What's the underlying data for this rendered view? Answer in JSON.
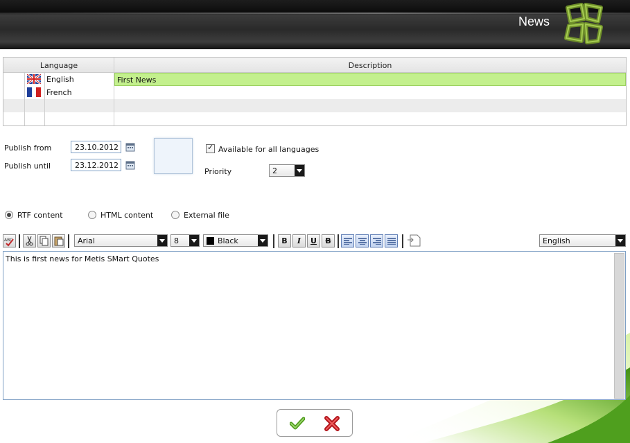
{
  "header": {
    "title": "News",
    "logo": "flower-logo"
  },
  "grid": {
    "columns": [
      "Language",
      "Description"
    ],
    "rows": [
      {
        "flag": "uk-flag-icon",
        "language": "English",
        "description": "First News",
        "selected": true
      },
      {
        "flag": "france-flag-icon",
        "language": "French",
        "description": ""
      }
    ]
  },
  "publish": {
    "from_label": "Publish from",
    "from_value": "23.10.2012",
    "until_label": "Publish until",
    "until_value": "23.12.2012"
  },
  "options": {
    "available_label": "Available for all languages",
    "available_checked": true,
    "priority_label": "Priority",
    "priority_value": "2"
  },
  "content_type": {
    "rtf_label": "RTF content",
    "html_label": "HTML content",
    "external_label": "External file",
    "selected": "rtf"
  },
  "toolbar": {
    "font": "Arial",
    "size": "8",
    "color": "Black",
    "language": "English",
    "bold": "B",
    "italic": "I",
    "underline": "U",
    "strike": "B"
  },
  "editor": {
    "text": "This is first news for Metis SMart Quotes"
  },
  "colors": {
    "accent_green": "#8dc63f",
    "selection_green": "#c3f08d",
    "field_border": "#7fa0c5"
  }
}
